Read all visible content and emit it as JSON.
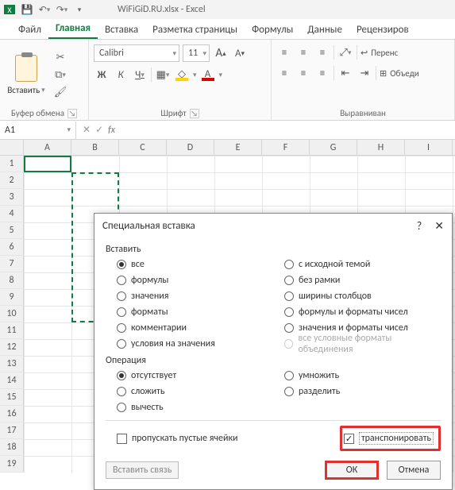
{
  "title": "WiFiGiD.RU.xlsx - Excel",
  "tabs": [
    "Файл",
    "Главная",
    "Вставка",
    "Разметка страницы",
    "Формулы",
    "Данные",
    "Рецензиров"
  ],
  "active_tab": "Главная",
  "clipboard": {
    "paste": "Вставить",
    "group": "Буфер обмена"
  },
  "font": {
    "name": "Calibri",
    "size": "11",
    "group": "Шрифт",
    "aa_big": "A",
    "aa_small": "A"
  },
  "align": {
    "wrap": "Перенс",
    "merge": "Объеди",
    "group": "Выравниван"
  },
  "namebox": "A1",
  "fx": "fx",
  "cols": [
    "A",
    "B",
    "C",
    "D",
    "E",
    "F",
    "G",
    "H",
    "I"
  ],
  "rows": [
    "1",
    "2",
    "3",
    "4",
    "5",
    "6",
    "7",
    "8",
    "9",
    "10",
    "11",
    "12",
    "13",
    "14",
    "15",
    "16",
    "17",
    "18",
    "19"
  ],
  "dialog": {
    "title": "Специальная вставка",
    "help": "?",
    "close": "✕",
    "paste_sect": "Вставить",
    "paste_left": [
      "все",
      "формулы",
      "значения",
      "форматы",
      "комментарии",
      "условия на значения"
    ],
    "paste_right": [
      "с исходной темой",
      "без рамки",
      "ширины столбцов",
      "формулы и форматы чисел",
      "значения и форматы чисел",
      "все условные форматы объединения"
    ],
    "paste_selected": "все",
    "paste_disabled": "все условные форматы объединения",
    "op_sect": "Операция",
    "op_left": [
      "отсутствует",
      "сложить",
      "вычесть"
    ],
    "op_right": [
      "умножить",
      "разделить"
    ],
    "op_selected": "отсутствует",
    "skip": "пропускать пустые ячейки",
    "transp": "транспонировать",
    "link": "Вставить связь",
    "ok": "ОК",
    "cancel": "Отмена"
  }
}
